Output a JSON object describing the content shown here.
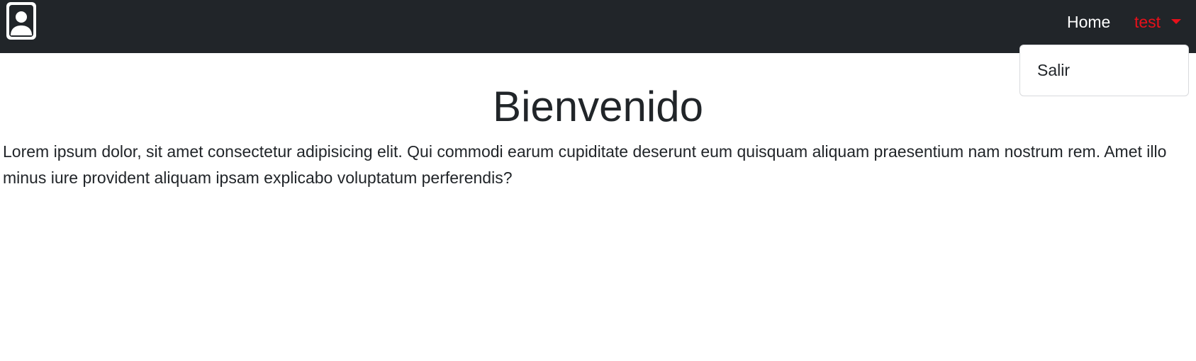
{
  "navbar": {
    "logo_icon": "user-profile-icon",
    "home_label": "Home",
    "user_label": "test",
    "user_color": "#e8101a",
    "background": "#212529"
  },
  "dropdown": {
    "items": [
      {
        "label": "Salir"
      }
    ]
  },
  "main": {
    "title": "Bienvenido",
    "body": "Lorem ipsum dolor, sit amet consectetur adipisicing elit. Qui commodi earum cupiditate deserunt eum quisquam aliquam praesentium nam nostrum rem. Amet illo minus iure provident aliquam ipsam explicabo voluptatum perferendis?"
  }
}
